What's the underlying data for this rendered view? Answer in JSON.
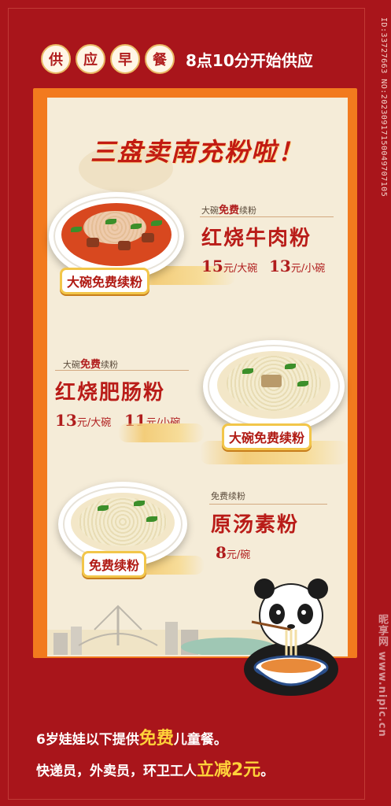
{
  "side_id": "ID:33727663 NO:20230917150049707105",
  "breakfast": {
    "chars": [
      "供",
      "应",
      "早",
      "餐"
    ],
    "time": "8点10分开始供应"
  },
  "headline": "三盘卖南充粉啦！",
  "items": [
    {
      "tag_prefix": "大碗",
      "tag_free": "免费",
      "tag_suffix": "续粉",
      "name": "红烧牛肉粉",
      "price1": "15",
      "unit1": "元/大碗",
      "price2": "13",
      "unit2": "元/小碗",
      "sticker": "大碗免费续粉"
    },
    {
      "tag_prefix": "大碗",
      "tag_free": "免费",
      "tag_suffix": "续粉",
      "name": "红烧肥肠粉",
      "price1": "13",
      "unit1": "元/大碗",
      "price2": "11",
      "unit2": "元/小碗",
      "sticker": "大碗免费续粉"
    },
    {
      "tag": "免费续粉",
      "name": "原汤素粉",
      "price1": "8",
      "unit1": "元/碗",
      "sticker": "免费续粉"
    }
  ],
  "bottom": {
    "line1_a": "6岁娃娃以下提供",
    "line1_hl": "免费",
    "line1_b": "儿童餐。",
    "line2_a": "快递员，外卖员，环卫工人",
    "line2_hl": "立减2元",
    "line2_b": "。"
  },
  "watermark": "昵享网 www.nipic.cn",
  "colors": {
    "background": "#a9151b",
    "frame": "#f27a1e",
    "paper": "#f5ecd8",
    "title_red": "#c21b12",
    "highlight": "#ffd23a"
  }
}
